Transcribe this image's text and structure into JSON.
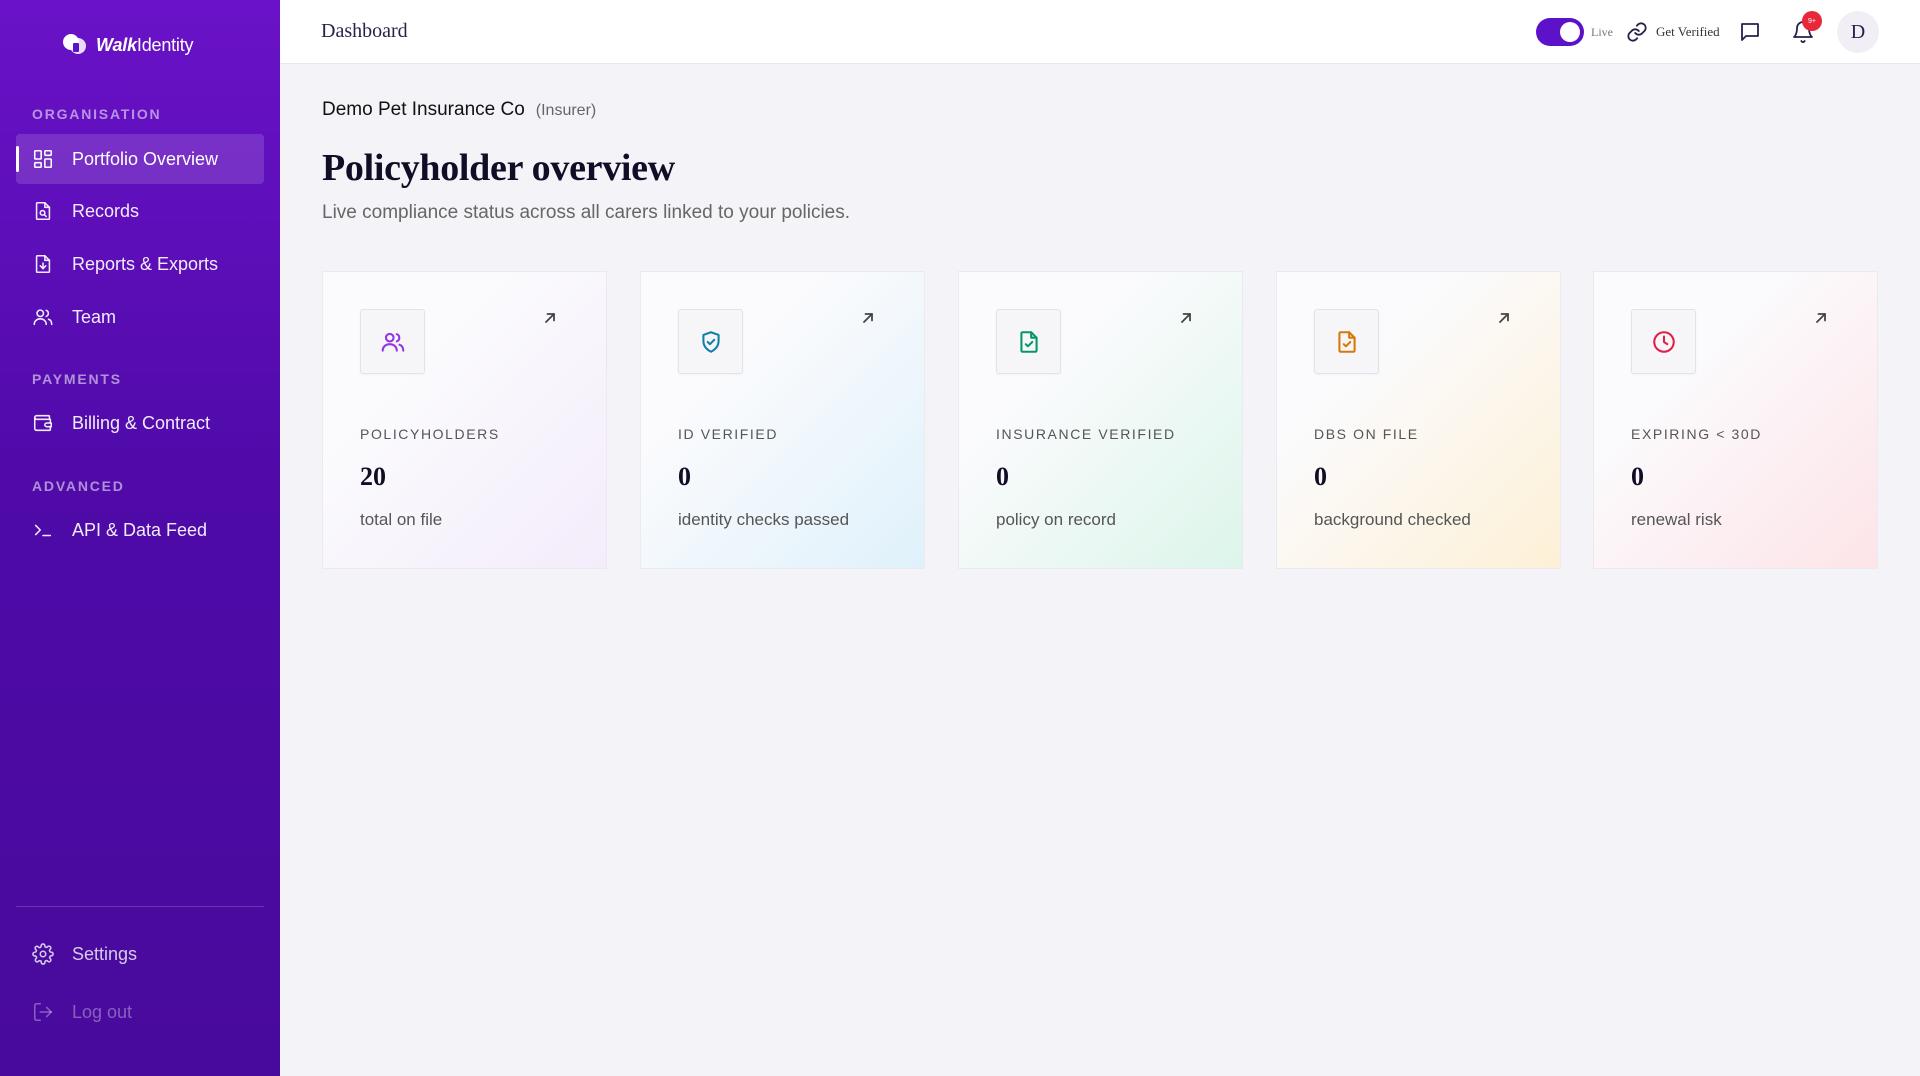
{
  "app": {
    "brand_bold": "Walk",
    "brand_light": "Identity"
  },
  "sidebar": {
    "sections": [
      {
        "label": "ORGANISATION"
      },
      {
        "label": "PAYMENTS"
      },
      {
        "label": "ADVANCED"
      }
    ],
    "items": [
      {
        "label": "Portfolio Overview",
        "icon": "grid-icon",
        "active": true
      },
      {
        "label": "Records",
        "icon": "document-search-icon"
      },
      {
        "label": "Reports & Exports",
        "icon": "document-download-icon"
      },
      {
        "label": "Team",
        "icon": "users-icon"
      },
      {
        "label": "Billing & Contract",
        "icon": "wallet-icon"
      },
      {
        "label": "API & Data Feed",
        "icon": "terminal-icon"
      }
    ],
    "footer": [
      {
        "label": "Settings",
        "icon": "gear-icon"
      },
      {
        "label": "Log out",
        "icon": "logout-icon"
      }
    ]
  },
  "topbar": {
    "title": "Dashboard",
    "live_label": "Live",
    "verify_label": "Get Verified",
    "notification_count": "9+",
    "avatar_initial": "D"
  },
  "main": {
    "org_name": "Demo Pet Insurance Co",
    "org_type": "(Insurer)",
    "title": "Policyholder overview",
    "subtitle": "Live compliance status across all carers linked to your policies.",
    "cards": [
      {
        "label": "POLICYHOLDERS",
        "value": "20",
        "desc": "total on file",
        "icon": "users-icon",
        "color": "#9333ea",
        "tint": "#f3ecfb"
      },
      {
        "label": "ID VERIFIED",
        "value": "0",
        "desc": "identity checks passed",
        "icon": "shield-check-icon",
        "color": "#0e7fa6",
        "tint": "#dff1fb"
      },
      {
        "label": "INSURANCE VERIFIED",
        "value": "0",
        "desc": "policy on record",
        "icon": "document-check-icon",
        "color": "#059669",
        "tint": "#dcf5ea"
      },
      {
        "label": "DBS ON FILE",
        "value": "0",
        "desc": "background checked",
        "icon": "document-check-icon",
        "color": "#d97706",
        "tint": "#fdf0d6"
      },
      {
        "label": "EXPIRING < 30D",
        "value": "0",
        "desc": "renewal risk",
        "icon": "clock-icon",
        "color": "#e11d48",
        "tint": "#fde4e8"
      }
    ]
  }
}
